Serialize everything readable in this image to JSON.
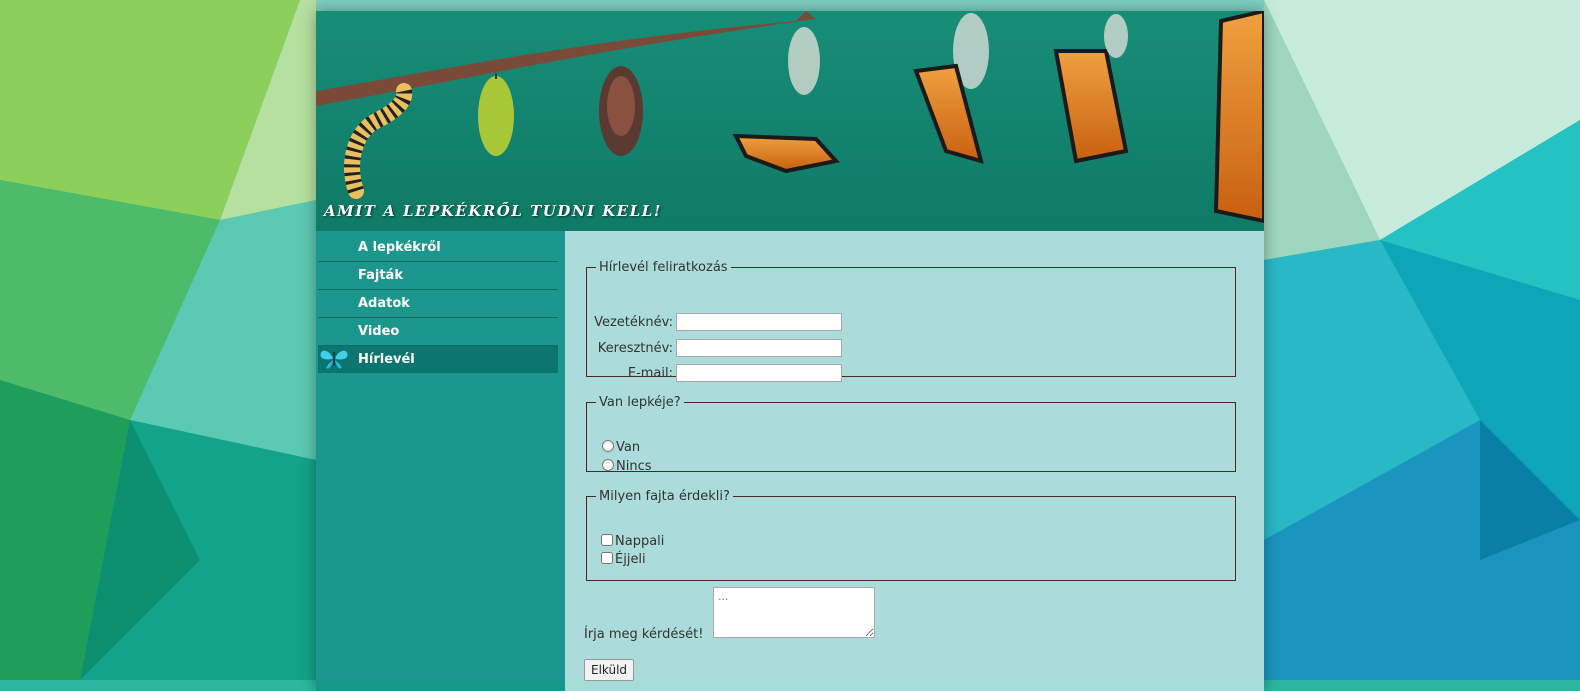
{
  "header": {
    "title": "Amit a lepkékről tudni kell!"
  },
  "nav": {
    "items": [
      {
        "label": "A lepkékről"
      },
      {
        "label": "Fajták"
      },
      {
        "label": "Adatok"
      },
      {
        "label": "Video"
      },
      {
        "label": "Hírlevél",
        "active": true
      }
    ]
  },
  "form": {
    "subscription": {
      "legend": "Hírlevél feliratkozás",
      "last_name_label": "Vezetéknév:",
      "last_name_value": "",
      "first_name_label": "Keresztnév:",
      "first_name_value": "",
      "email_label": "E-mail:",
      "email_value": ""
    },
    "has_butterfly": {
      "legend": "Van lepkéje?",
      "options": [
        "Van",
        "Nincs"
      ]
    },
    "interest": {
      "legend": "Milyen fajta érdekli?",
      "options": [
        "Nappali",
        "Éjjeli"
      ]
    },
    "question_label": "Írja meg kérdését!",
    "question_placeholder": "...",
    "submit_label": "Elküld"
  },
  "colors": {
    "sidebar": "#0a8a80",
    "content_panel": "#d7ebee",
    "fieldset_border": "#4a2a20"
  }
}
